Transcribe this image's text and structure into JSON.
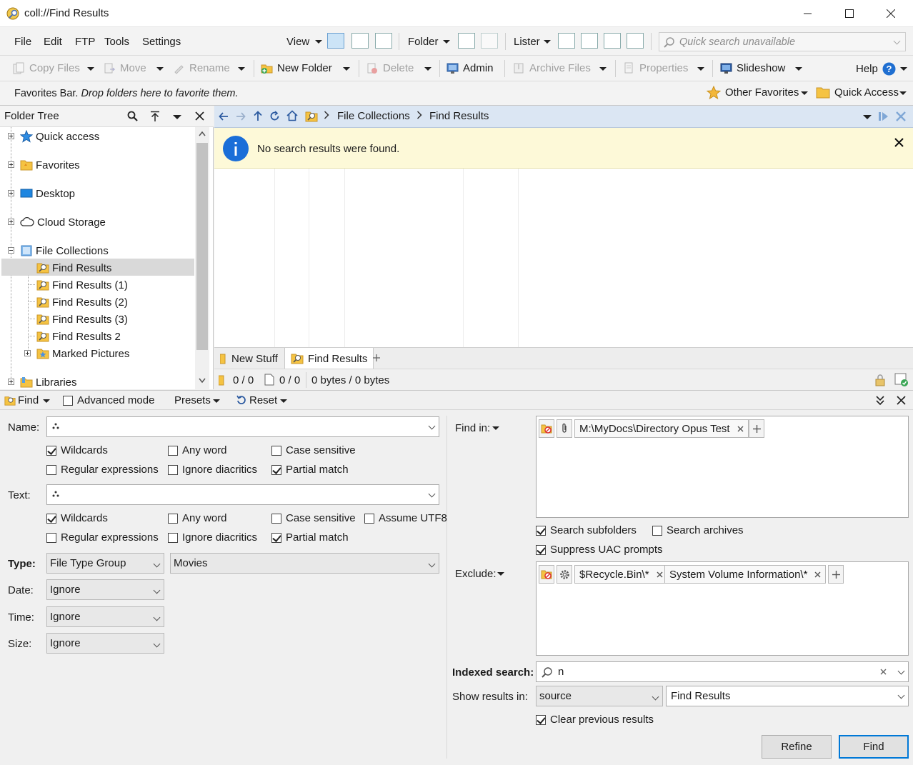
{
  "window": {
    "title": "coll://Find Results"
  },
  "menu": {
    "file": "File",
    "edit": "Edit",
    "ftp": "FTP",
    "tools": "Tools",
    "settings": "Settings"
  },
  "toolbar1": {
    "view": "View",
    "folder": "Folder",
    "lister": "Lister",
    "search_placeholder": "Quick search unavailable"
  },
  "toolbar2": {
    "copy": "Copy Files",
    "move": "Move",
    "rename": "Rename",
    "new_folder": "New Folder",
    "delete": "Delete",
    "admin": "Admin",
    "archive": "Archive Files",
    "properties": "Properties",
    "slideshow": "Slideshow",
    "help": "Help"
  },
  "favbar": {
    "hint_prefix": "Favorites Bar.",
    "hint_italic": "Drop folders here to favorite them.",
    "other": "Other Favorites",
    "quick": "Quick Access"
  },
  "tree": {
    "title": "Folder Tree",
    "items": [
      {
        "label": "Quick access"
      },
      {
        "label": "Favorites"
      },
      {
        "label": "Desktop"
      },
      {
        "label": "Cloud Storage"
      },
      {
        "label": "File Collections"
      },
      {
        "label": "Find Results"
      },
      {
        "label": "Find Results (1)"
      },
      {
        "label": "Find Results (2)"
      },
      {
        "label": "Find Results (3)"
      },
      {
        "label": "Find Results 2"
      },
      {
        "label": "Marked Pictures"
      },
      {
        "label": "Libraries"
      }
    ]
  },
  "path": {
    "segments": [
      "File Collections",
      "Find Results"
    ]
  },
  "infobar": {
    "message": "No search results were found."
  },
  "tabs": [
    {
      "label": "New Stuff"
    },
    {
      "label": "Find Results"
    }
  ],
  "status": {
    "folders": "0 / 0",
    "files": "0 / 0",
    "bytes": "0 bytes / 0 bytes"
  },
  "find": {
    "mode": "Find",
    "advanced": "Advanced mode",
    "presets": "Presets",
    "reset": "Reset",
    "name_label": "Name:",
    "text_label": "Text:",
    "type_label": "Type:",
    "date_label": "Date:",
    "time_label": "Time:",
    "size_label": "Size:",
    "name_opts": {
      "wildcards": "Wildcards",
      "any_word": "Any word",
      "case": "Case sensitive",
      "regex": "Regular expressions",
      "diacritics": "Ignore diacritics",
      "partial": "Partial match"
    },
    "text_opts": {
      "wildcards": "Wildcards",
      "any_word": "Any word",
      "case": "Case sensitive",
      "utf8": "Assume UTF8",
      "regex": "Regular expressions",
      "diacritics": "Ignore diacritics",
      "partial": "Partial match"
    },
    "type_value": "File Type Group",
    "type_group": "Movies",
    "date_value": "Ignore",
    "time_value": "Ignore",
    "size_value": "Ignore",
    "find_in_label": "Find in:",
    "find_in_path": "M:\\MyDocs\\Directory Opus Test",
    "subfolders": "Search subfolders",
    "archives": "Search archives",
    "uac": "Suppress UAC prompts",
    "exclude_label": "Exclude:",
    "exclude_items": [
      "$Recycle.Bin\\*",
      "System Volume Information\\*"
    ],
    "indexed_label": "Indexed search:",
    "indexed_value": "n",
    "show_label": "Show results in:",
    "show_value": "source",
    "show_target": "Find Results",
    "clear": "Clear previous results",
    "refine": "Refine",
    "find_btn": "Find"
  },
  "colors": {
    "accent": "#0078d7",
    "info_bg": "#fdf9d8",
    "path_bg": "#dbe6f3",
    "folder": "#f5c342"
  }
}
